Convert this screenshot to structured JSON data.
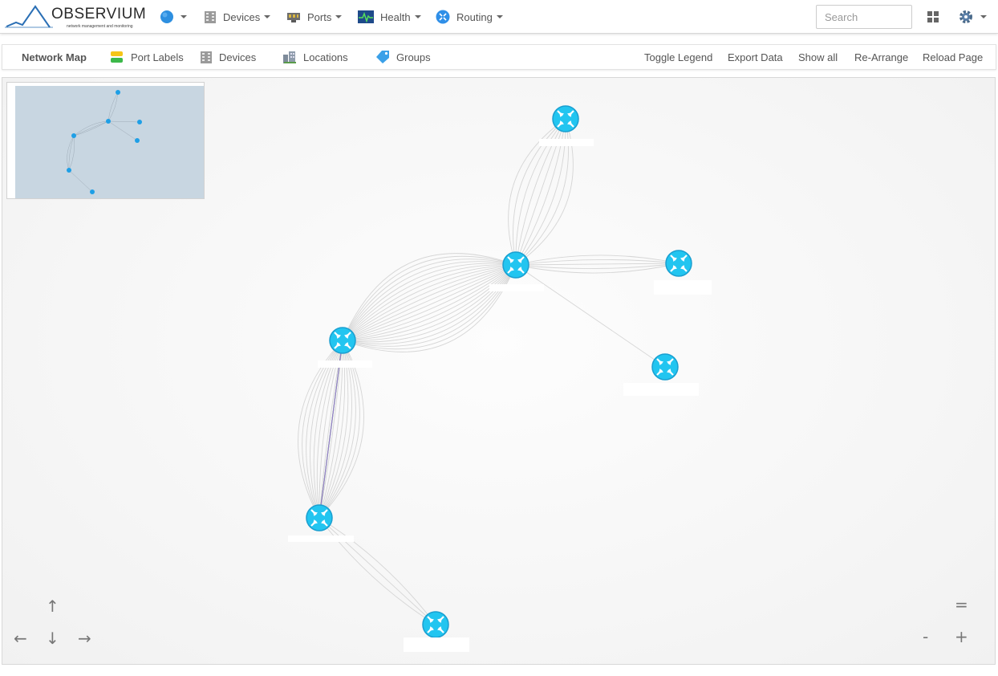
{
  "brand": {
    "name": "OBSERVIUM",
    "tagline": "network management and monitoring"
  },
  "nav": {
    "globe_icon": "globe-icon",
    "devices_label": "Devices",
    "ports_label": "Ports",
    "health_label": "Health",
    "routing_label": "Routing",
    "search_placeholder": "Search",
    "windows_icon": "windows-icon",
    "settings_icon": "gear-icon"
  },
  "toolbar": {
    "title": "Network Map",
    "port_labels": "Port Labels",
    "devices": "Devices",
    "locations": "Locations",
    "groups": "Groups",
    "toggle_legend": "Toggle Legend",
    "export_data": "Export Data",
    "show_all": "Show all",
    "rearrange": "Re-Arrange",
    "reload_page": "Reload Page"
  },
  "map": {
    "node_icon": "router-icon",
    "node_color": "#22c5f0",
    "link_color": "#cfcfcf",
    "highlight_link_colors": [
      "#5cd65c",
      "#a36ae0"
    ],
    "minimap_bg": "#c8d6e1"
  },
  "controls": {
    "up": "↑",
    "down": "↓",
    "left": "←",
    "right": "→",
    "zoom_reset": "=",
    "zoom_out": "-",
    "zoom_in": "+"
  }
}
